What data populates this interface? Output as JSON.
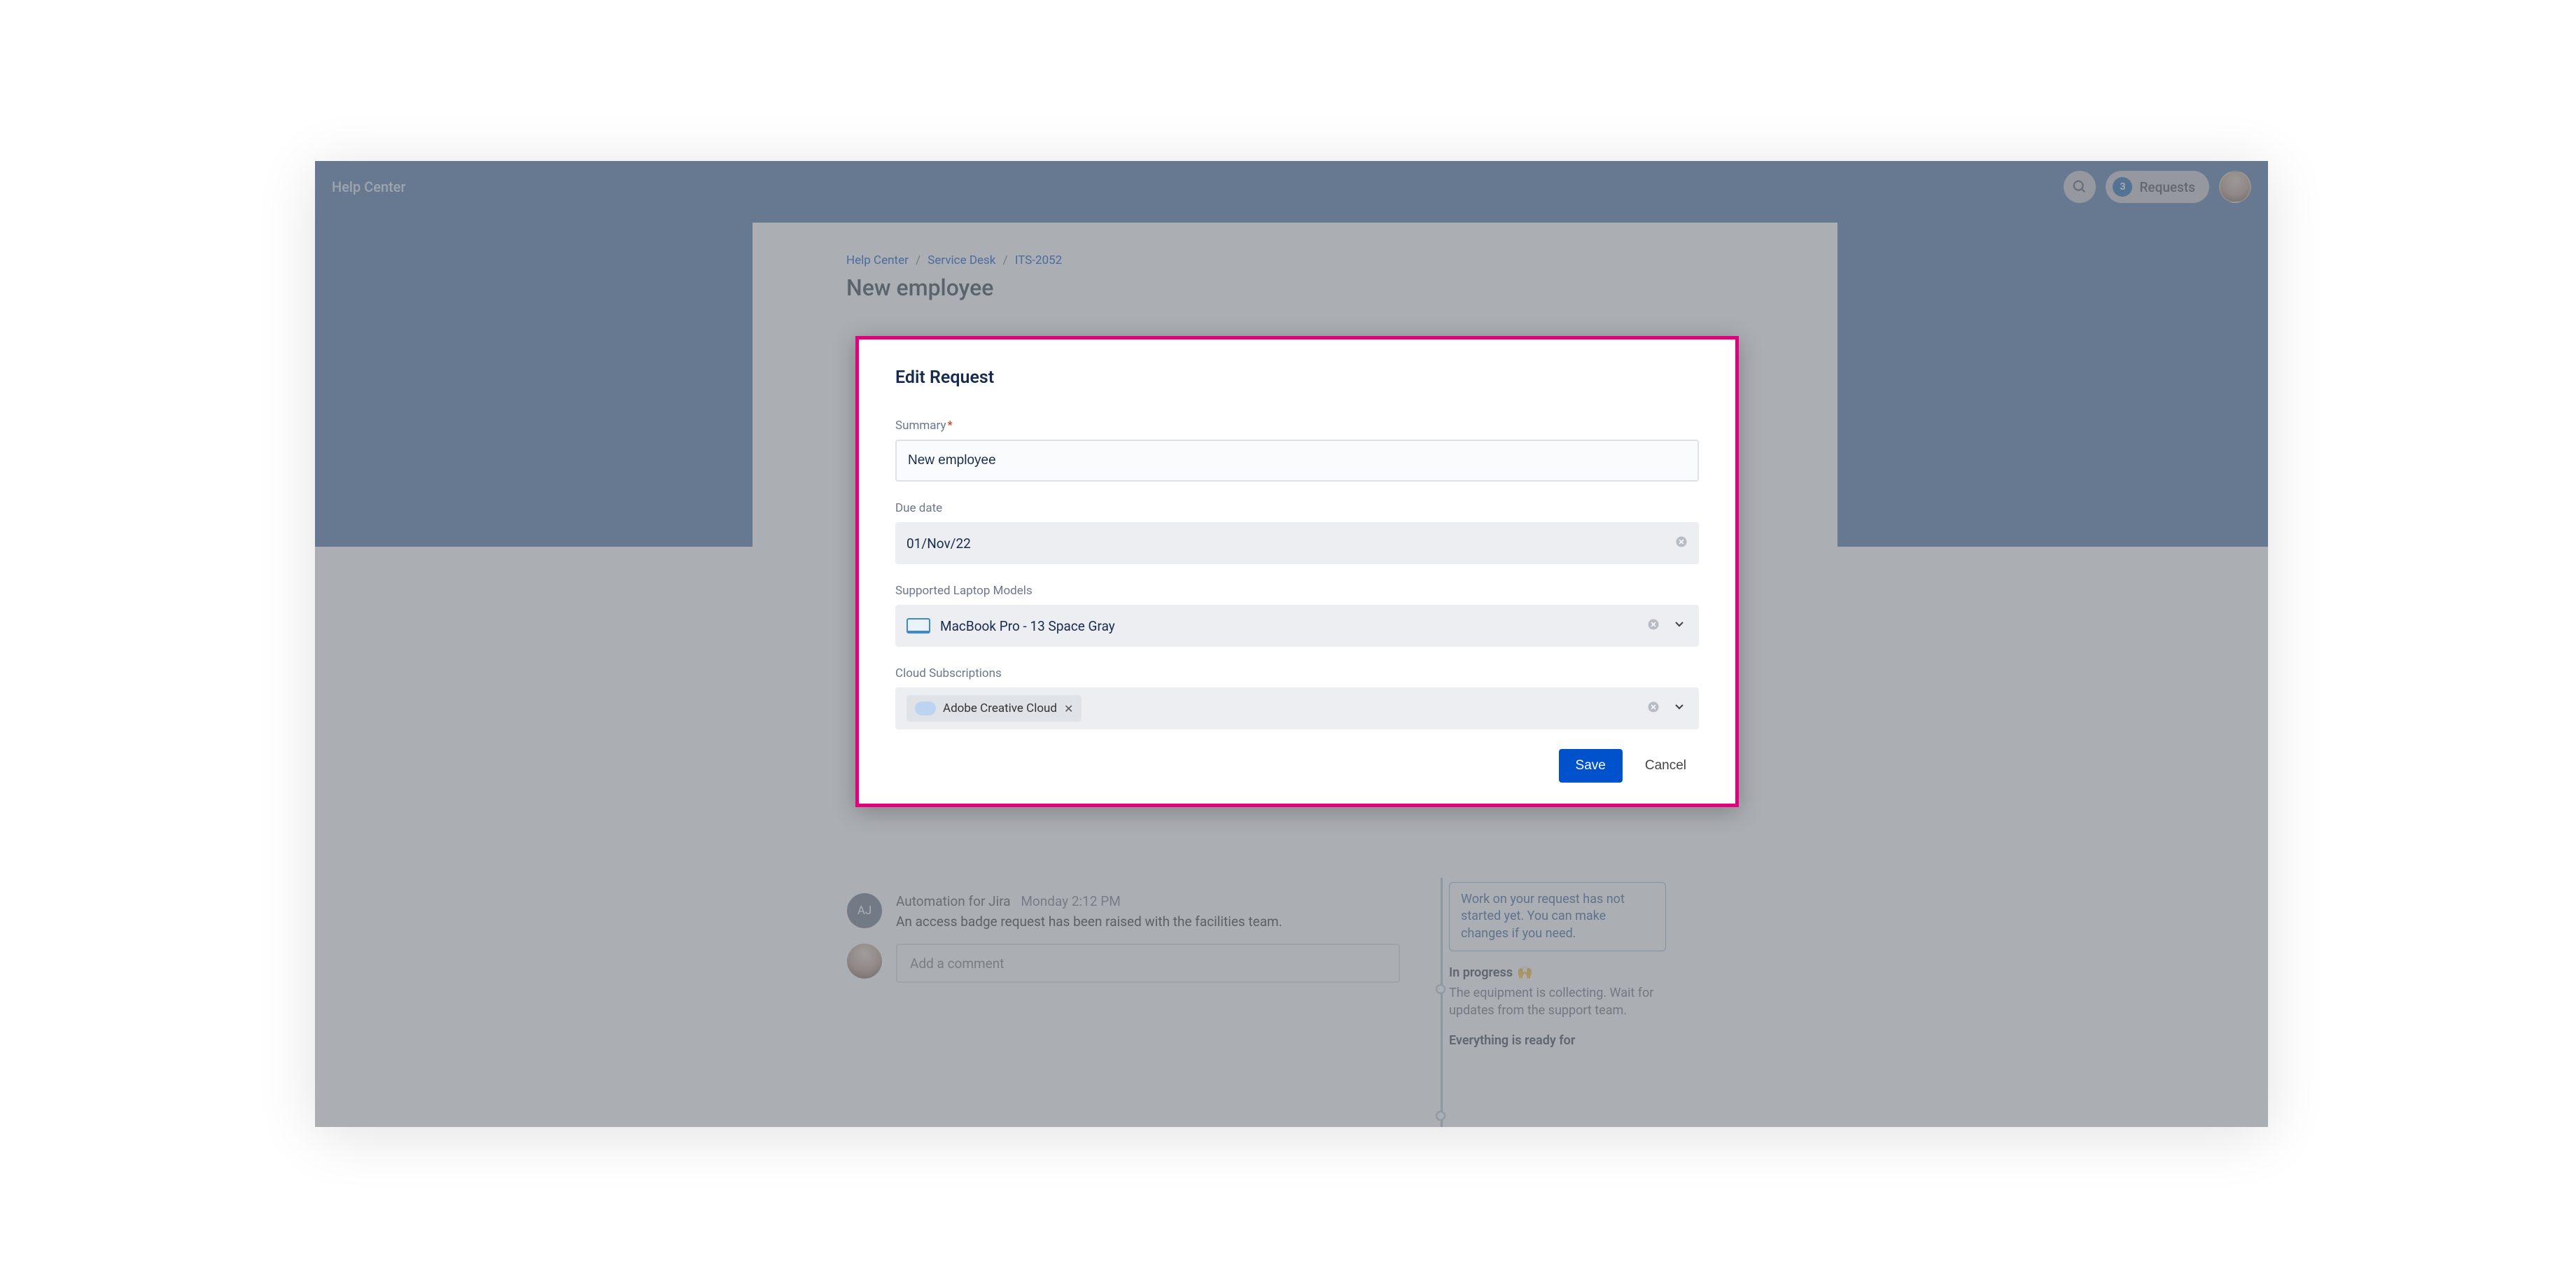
{
  "header": {
    "brand": "Help Center",
    "requests_count": "3",
    "requests_label": "Requests"
  },
  "breadcrumbs": {
    "a": "Help Center",
    "b": "Service Desk",
    "c": "ITS-2052"
  },
  "page": {
    "title": "New employee"
  },
  "modal": {
    "title": "Edit Request",
    "summary_label": "Summary",
    "summary_value": "New employee",
    "due_label": "Due date",
    "due_value": "01/Nov/22",
    "laptop_label": "Supported Laptop Models",
    "laptop_value": "MacBook Pro - 13 Space Gray",
    "cloud_label": "Cloud Subscriptions",
    "cloud_tag": "Adobe Creative Cloud",
    "save": "Save",
    "cancel": "Cancel"
  },
  "activity": {
    "aj_initials": "AJ",
    "author": "Automation for Jira",
    "time": "Monday 2:12 PM",
    "body": "An access badge request has been raised with the facilities team.",
    "comment_placeholder": "Add a comment"
  },
  "steps": {
    "open_body": "Work on your request has not started yet. You can make changes if you need.",
    "in_progress_title": "In progress",
    "in_progress_body": "The equipment is collecting. Wait for updates from the support team.",
    "ready_title": "Everything is ready for"
  }
}
